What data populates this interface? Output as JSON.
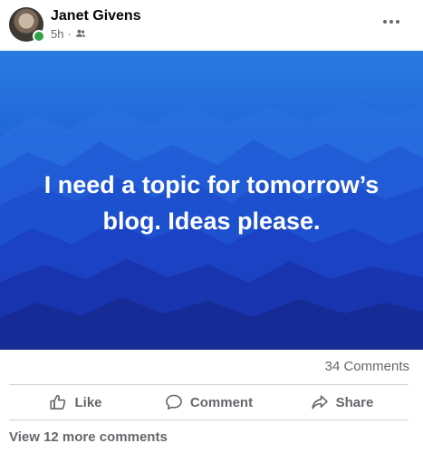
{
  "post": {
    "author": "Janet Givens",
    "time": "5h",
    "separator": "·",
    "audience_icon": "friends-icon",
    "author_online": true,
    "body_text": "I need a topic for tomorrow’s blog. Ideas please.",
    "background": {
      "colors": [
        "#2a7ae0",
        "#1f63d8",
        "#1848c9",
        "#1a2fa8"
      ]
    }
  },
  "stats": {
    "comments": "34 Comments"
  },
  "actions": {
    "like": "Like",
    "comment": "Comment",
    "share": "Share"
  },
  "footer": {
    "view_more": "View 12 more comments"
  },
  "colors": {
    "online": "#31a24c",
    "secondary_text": "#65676b",
    "divider": "#ced0d4"
  }
}
